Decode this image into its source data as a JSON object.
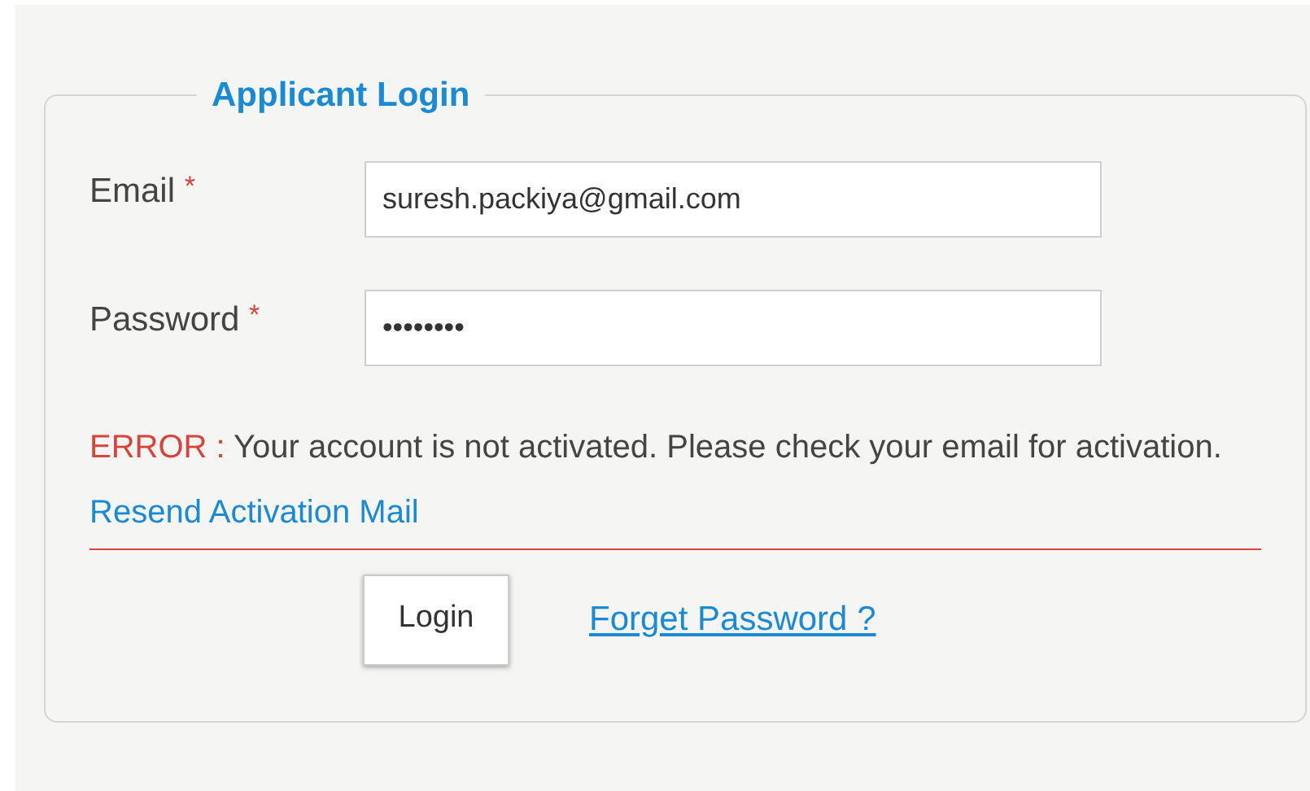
{
  "form": {
    "legend": "Applicant Login",
    "fields": [
      {
        "label": "Email",
        "required_mark": "*",
        "value": "suresh.packiya@gmail.com"
      },
      {
        "label": "Password",
        "required_mark": "*",
        "value": "••••••••"
      }
    ],
    "error": {
      "prefix": "ERROR :",
      "message": "Your account is not activated. Please check your email for activation.",
      "link": "Resend Activation Mail"
    },
    "login_button": "Login",
    "forgot_link": "Forget Password ?"
  }
}
